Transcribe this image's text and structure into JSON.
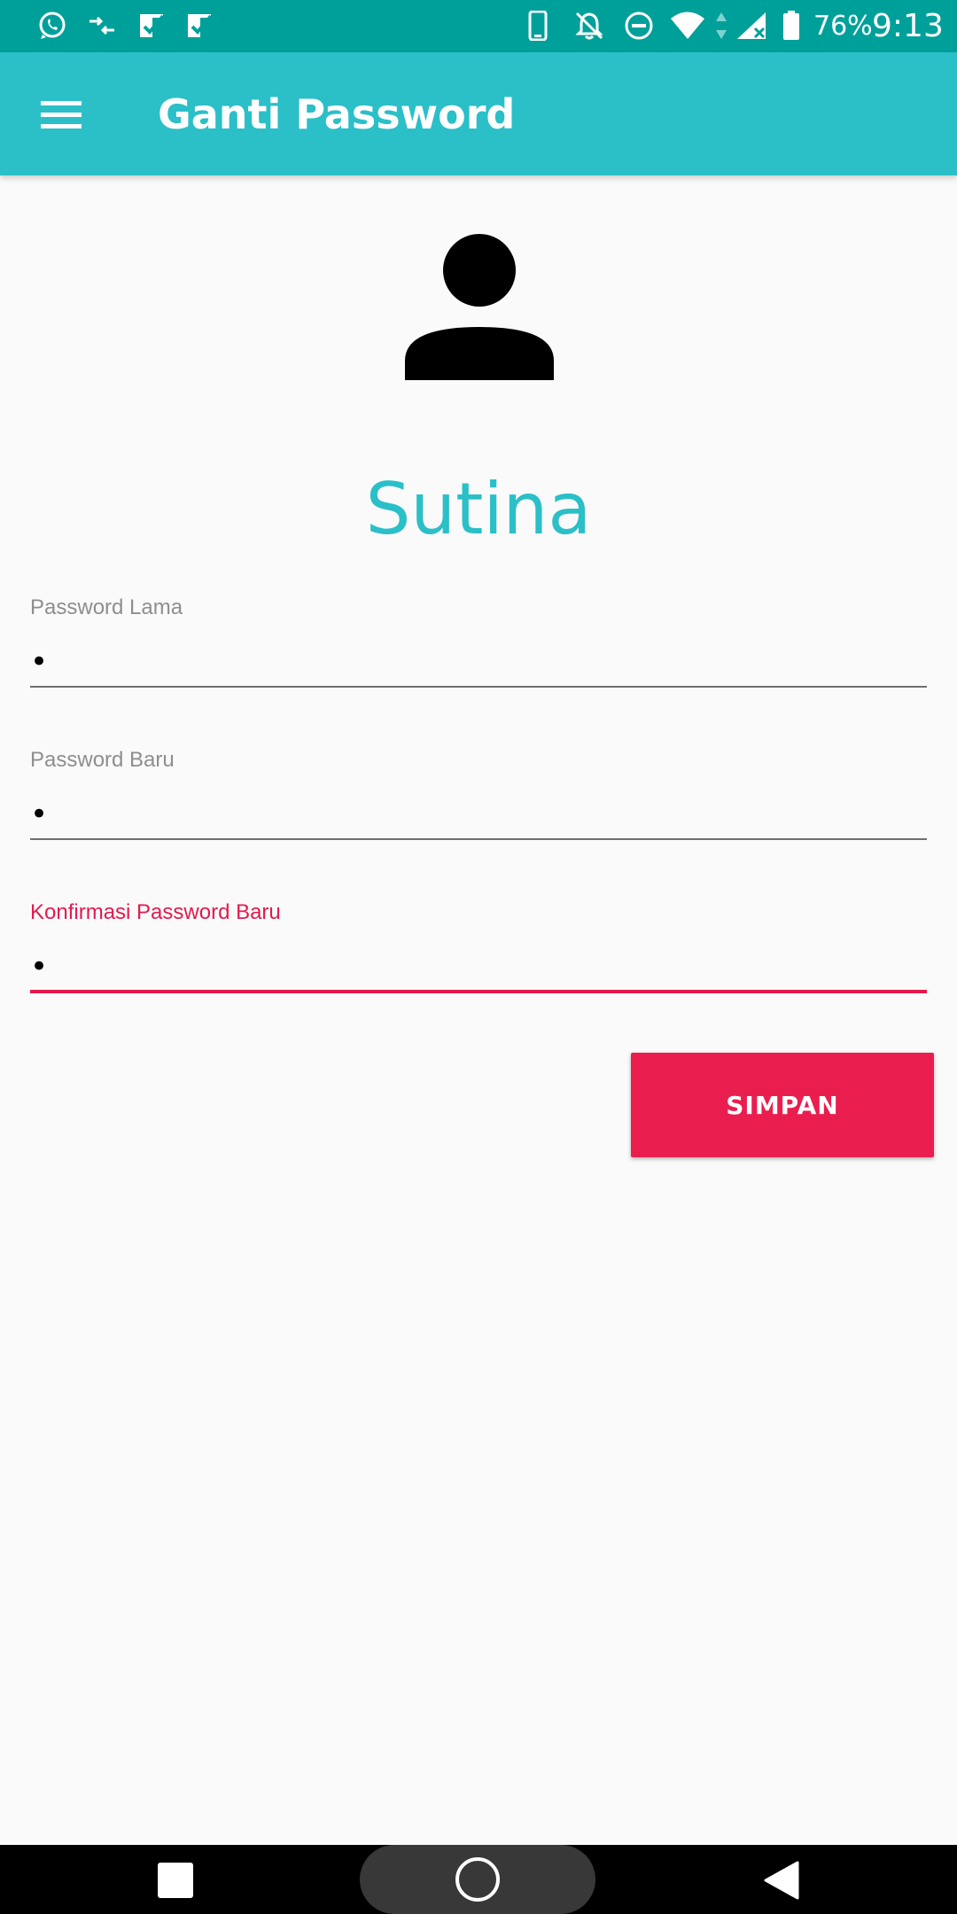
{
  "status_bar": {
    "battery": "76%",
    "time": "9:13",
    "icons": [
      "whatsapp-icon",
      "data-saver-icon",
      "task-check-icon",
      "task-check-icon",
      "phone-icon",
      "notifications-off-icon",
      "do-not-disturb-icon",
      "wifi-icon",
      "data-activity-icon",
      "signal-icon",
      "battery-icon"
    ],
    "background_color": "#00a09a"
  },
  "app_bar": {
    "title": "Ganti Password",
    "menu_icon": "menu-icon",
    "background_color": "#2bbfc8"
  },
  "profile": {
    "avatar_icon": "person-icon",
    "name": "Sutina",
    "name_color": "#2bbfc8"
  },
  "form": {
    "old_password": {
      "label": "Password Lama",
      "value": "•"
    },
    "new_password": {
      "label": "Password Baru",
      "value": "•"
    },
    "confirm_password": {
      "label": "Konfirmasi Password Baru",
      "value": "•",
      "focused": true
    },
    "accent_color": "#e21b4e"
  },
  "save_button": {
    "label": "SIMPAN",
    "color": "#e91e4f"
  },
  "nav_bar": {
    "icons": [
      "recents-icon",
      "home-icon",
      "back-icon"
    ]
  }
}
